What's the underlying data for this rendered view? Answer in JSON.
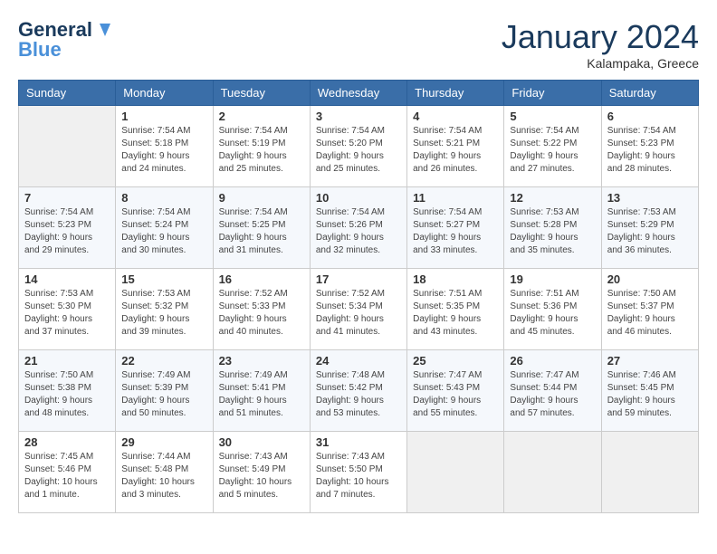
{
  "header": {
    "logo_line1": "General",
    "logo_line2": "Blue",
    "month": "January 2024",
    "location": "Kalampaka, Greece"
  },
  "weekdays": [
    "Sunday",
    "Monday",
    "Tuesday",
    "Wednesday",
    "Thursday",
    "Friday",
    "Saturday"
  ],
  "weeks": [
    [
      {
        "day": "",
        "info": ""
      },
      {
        "day": "1",
        "info": "Sunrise: 7:54 AM\nSunset: 5:18 PM\nDaylight: 9 hours\nand 24 minutes."
      },
      {
        "day": "2",
        "info": "Sunrise: 7:54 AM\nSunset: 5:19 PM\nDaylight: 9 hours\nand 25 minutes."
      },
      {
        "day": "3",
        "info": "Sunrise: 7:54 AM\nSunset: 5:20 PM\nDaylight: 9 hours\nand 25 minutes."
      },
      {
        "day": "4",
        "info": "Sunrise: 7:54 AM\nSunset: 5:21 PM\nDaylight: 9 hours\nand 26 minutes."
      },
      {
        "day": "5",
        "info": "Sunrise: 7:54 AM\nSunset: 5:22 PM\nDaylight: 9 hours\nand 27 minutes."
      },
      {
        "day": "6",
        "info": "Sunrise: 7:54 AM\nSunset: 5:23 PM\nDaylight: 9 hours\nand 28 minutes."
      }
    ],
    [
      {
        "day": "7",
        "info": "Sunrise: 7:54 AM\nSunset: 5:23 PM\nDaylight: 9 hours\nand 29 minutes."
      },
      {
        "day": "8",
        "info": "Sunrise: 7:54 AM\nSunset: 5:24 PM\nDaylight: 9 hours\nand 30 minutes."
      },
      {
        "day": "9",
        "info": "Sunrise: 7:54 AM\nSunset: 5:25 PM\nDaylight: 9 hours\nand 31 minutes."
      },
      {
        "day": "10",
        "info": "Sunrise: 7:54 AM\nSunset: 5:26 PM\nDaylight: 9 hours\nand 32 minutes."
      },
      {
        "day": "11",
        "info": "Sunrise: 7:54 AM\nSunset: 5:27 PM\nDaylight: 9 hours\nand 33 minutes."
      },
      {
        "day": "12",
        "info": "Sunrise: 7:53 AM\nSunset: 5:28 PM\nDaylight: 9 hours\nand 35 minutes."
      },
      {
        "day": "13",
        "info": "Sunrise: 7:53 AM\nSunset: 5:29 PM\nDaylight: 9 hours\nand 36 minutes."
      }
    ],
    [
      {
        "day": "14",
        "info": "Sunrise: 7:53 AM\nSunset: 5:30 PM\nDaylight: 9 hours\nand 37 minutes."
      },
      {
        "day": "15",
        "info": "Sunrise: 7:53 AM\nSunset: 5:32 PM\nDaylight: 9 hours\nand 39 minutes."
      },
      {
        "day": "16",
        "info": "Sunrise: 7:52 AM\nSunset: 5:33 PM\nDaylight: 9 hours\nand 40 minutes."
      },
      {
        "day": "17",
        "info": "Sunrise: 7:52 AM\nSunset: 5:34 PM\nDaylight: 9 hours\nand 41 minutes."
      },
      {
        "day": "18",
        "info": "Sunrise: 7:51 AM\nSunset: 5:35 PM\nDaylight: 9 hours\nand 43 minutes."
      },
      {
        "day": "19",
        "info": "Sunrise: 7:51 AM\nSunset: 5:36 PM\nDaylight: 9 hours\nand 45 minutes."
      },
      {
        "day": "20",
        "info": "Sunrise: 7:50 AM\nSunset: 5:37 PM\nDaylight: 9 hours\nand 46 minutes."
      }
    ],
    [
      {
        "day": "21",
        "info": "Sunrise: 7:50 AM\nSunset: 5:38 PM\nDaylight: 9 hours\nand 48 minutes."
      },
      {
        "day": "22",
        "info": "Sunrise: 7:49 AM\nSunset: 5:39 PM\nDaylight: 9 hours\nand 50 minutes."
      },
      {
        "day": "23",
        "info": "Sunrise: 7:49 AM\nSunset: 5:41 PM\nDaylight: 9 hours\nand 51 minutes."
      },
      {
        "day": "24",
        "info": "Sunrise: 7:48 AM\nSunset: 5:42 PM\nDaylight: 9 hours\nand 53 minutes."
      },
      {
        "day": "25",
        "info": "Sunrise: 7:47 AM\nSunset: 5:43 PM\nDaylight: 9 hours\nand 55 minutes."
      },
      {
        "day": "26",
        "info": "Sunrise: 7:47 AM\nSunset: 5:44 PM\nDaylight: 9 hours\nand 57 minutes."
      },
      {
        "day": "27",
        "info": "Sunrise: 7:46 AM\nSunset: 5:45 PM\nDaylight: 9 hours\nand 59 minutes."
      }
    ],
    [
      {
        "day": "28",
        "info": "Sunrise: 7:45 AM\nSunset: 5:46 PM\nDaylight: 10 hours\nand 1 minute."
      },
      {
        "day": "29",
        "info": "Sunrise: 7:44 AM\nSunset: 5:48 PM\nDaylight: 10 hours\nand 3 minutes."
      },
      {
        "day": "30",
        "info": "Sunrise: 7:43 AM\nSunset: 5:49 PM\nDaylight: 10 hours\nand 5 minutes."
      },
      {
        "day": "31",
        "info": "Sunrise: 7:43 AM\nSunset: 5:50 PM\nDaylight: 10 hours\nand 7 minutes."
      },
      {
        "day": "",
        "info": ""
      },
      {
        "day": "",
        "info": ""
      },
      {
        "day": "",
        "info": ""
      }
    ]
  ]
}
